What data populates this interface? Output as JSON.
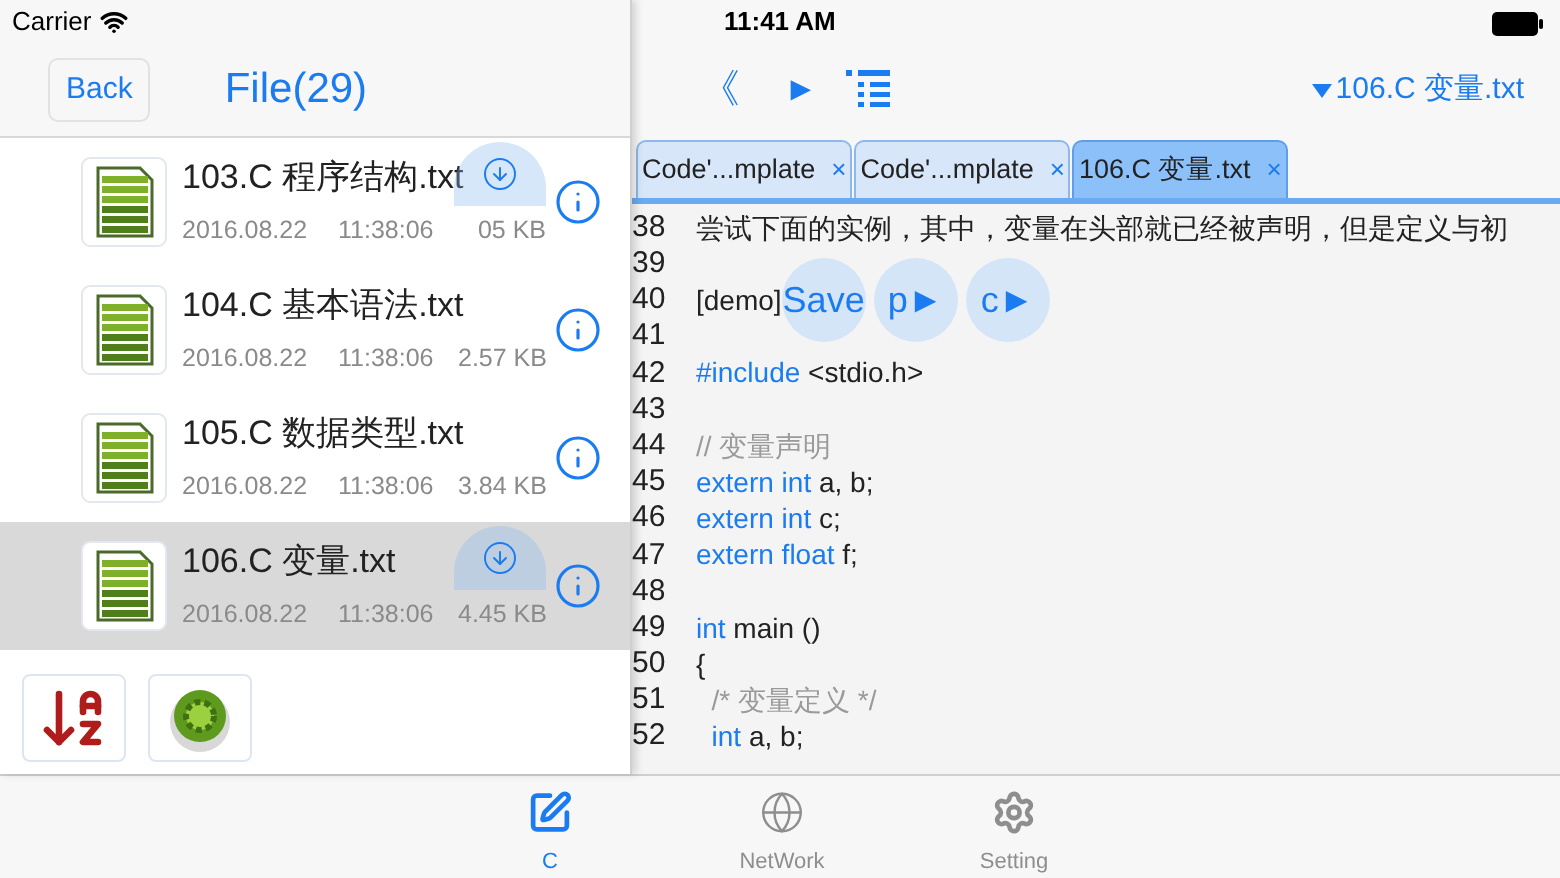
{
  "status_bar": {
    "carrier": "Carrier",
    "time": "11:41 AM"
  },
  "file_panel": {
    "back": "Back",
    "title": "File(29)",
    "files": [
      {
        "name": "103.C 程序结构.txt",
        "date": "2016.08.22",
        "time": "11:38:06",
        "size": "05 KB",
        "selected": false,
        "overlay_button": true
      },
      {
        "name": "104.C 基本语法.txt",
        "date": "2016.08.22",
        "time": "11:38:06",
        "size": "2.57 KB",
        "selected": false,
        "overlay_button": false
      },
      {
        "name": "105.C 数据类型.txt",
        "date": "2016.08.22",
        "time": "11:38:06",
        "size": "3.84 KB",
        "selected": false,
        "overlay_button": false
      },
      {
        "name": "106.C 变量.txt",
        "date": "2016.08.22",
        "time": "11:38:06",
        "size": "4.45 KB",
        "selected": true,
        "overlay_button": true
      }
    ]
  },
  "editor": {
    "toolbar": {
      "back_glyph": "《",
      "run_glyph": "►",
      "current_file": "106.C 变量.txt"
    },
    "tabs": [
      {
        "label": "Code'...mplate",
        "close": "×",
        "selected": false
      },
      {
        "label": "Code'...mplate",
        "close": "×",
        "selected": false
      },
      {
        "label": "106.C 变量.txt",
        "close": "×",
        "selected": true
      }
    ],
    "lines": [
      {
        "number": "38",
        "segments": [
          {
            "kind": "text",
            "text": "尝试下面的实例，其中，变量在头部就已经被声明，但是定义与初"
          }
        ]
      },
      {
        "number": "39"
      },
      {
        "number": "40",
        "segments": [
          {
            "kind": "text",
            "text": "[demo]"
          }
        ],
        "buttons": [
          "Save",
          "p►",
          "c►"
        ]
      },
      {
        "number": "41"
      },
      {
        "number": "42",
        "segments": [
          {
            "kind": "keyword",
            "text": "#include"
          },
          {
            "kind": "text",
            "text": " <stdio.h>"
          }
        ]
      },
      {
        "number": "43"
      },
      {
        "number": "44",
        "segments": [
          {
            "kind": "comment",
            "text": "// 变量声明"
          }
        ]
      },
      {
        "number": "45",
        "segments": [
          {
            "kind": "keyword",
            "text": "extern int"
          },
          {
            "kind": "text",
            "text": " a, b;"
          }
        ]
      },
      {
        "number": "46",
        "segments": [
          {
            "kind": "keyword",
            "text": "extern int"
          },
          {
            "kind": "text",
            "text": " c;"
          }
        ]
      },
      {
        "number": "47",
        "segments": [
          {
            "kind": "keyword",
            "text": "extern float"
          },
          {
            "kind": "text",
            "text": " f;"
          }
        ]
      },
      {
        "number": "48"
      },
      {
        "number": "49",
        "segments": [
          {
            "kind": "keyword",
            "text": "int"
          },
          {
            "kind": "text",
            "text": " main ()"
          }
        ]
      },
      {
        "number": "50",
        "segments": [
          {
            "kind": "text",
            "text": "{"
          }
        ]
      },
      {
        "number": "51",
        "segments": [
          {
            "kind": "comment",
            "text": "  /* 变量定义 */"
          }
        ]
      },
      {
        "number": "52",
        "segments": [
          {
            "kind": "keyword",
            "text": "  int"
          },
          {
            "kind": "text",
            "text": " a, b;"
          }
        ]
      }
    ]
  },
  "tab_bar": [
    {
      "label": "C",
      "kind": "edit",
      "selected": true
    },
    {
      "label": "NetWork",
      "kind": "globe",
      "selected": false
    },
    {
      "label": "Setting",
      "kind": "gear",
      "selected": false
    }
  ]
}
